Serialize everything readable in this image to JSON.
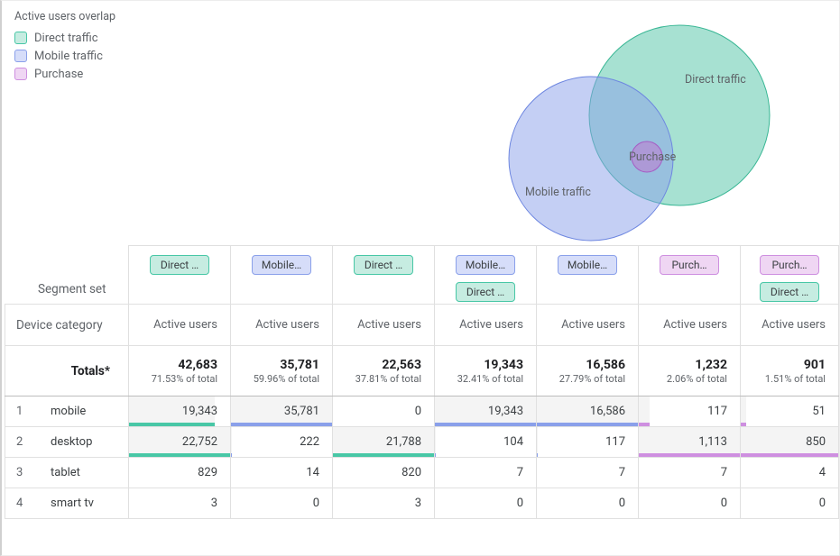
{
  "legend_title": "Active users overlap",
  "segments": [
    {
      "id": "direct",
      "label": "Direct traffic",
      "fill": "#c6ece1",
      "stroke": "#48c7a6"
    },
    {
      "id": "mobile",
      "label": "Mobile traffic",
      "fill": "#d6ddf9",
      "stroke": "#8aa0ea"
    },
    {
      "id": "purchase",
      "label": "Purchase",
      "fill": "#efd6f3",
      "stroke": "#ce8fe0"
    }
  ],
  "venn_labels": {
    "direct": "Direct traffic",
    "mobile": "Mobile traffic",
    "purchase": "Purchase"
  },
  "headings": {
    "segment_set": "Segment set",
    "dimension": "Device category",
    "metric": "Active users",
    "totals": "Totals*"
  },
  "columns": [
    {
      "chips": [
        0
      ],
      "total_val": "42,683",
      "total_pct": "71.53% of total"
    },
    {
      "chips": [
        1
      ],
      "total_val": "35,781",
      "total_pct": "59.96% of total"
    },
    {
      "chips": [
        0
      ],
      "total_val": "22,563",
      "total_pct": "37.81% of total"
    },
    {
      "chips": [
        1,
        0
      ],
      "total_val": "19,343",
      "total_pct": "32.41% of total"
    },
    {
      "chips": [
        1
      ],
      "total_val": "16,586",
      "total_pct": "27.79% of total"
    },
    {
      "chips": [
        2
      ],
      "total_val": "1,232",
      "total_pct": "2.06% of total"
    },
    {
      "chips": [
        2,
        0
      ],
      "total_val": "901",
      "total_pct": "1.51% of total"
    }
  ],
  "chip_text": {
    "direct": "Direct …",
    "mobile": "Mobile…",
    "purchase": "Purch…"
  },
  "rows": [
    {
      "idx": "1",
      "category": "mobile",
      "cells": [
        "19,343",
        "35,781",
        "0",
        "19,343",
        "16,586",
        "117",
        "51"
      ]
    },
    {
      "idx": "2",
      "category": "desktop",
      "cells": [
        "22,752",
        "222",
        "21,788",
        "104",
        "117",
        "1,113",
        "850"
      ]
    },
    {
      "idx": "3",
      "category": "tablet",
      "cells": [
        "829",
        "14",
        "820",
        "7",
        "7",
        "7",
        "4"
      ]
    },
    {
      "idx": "4",
      "category": "smart tv",
      "cells": [
        "3",
        "0",
        "3",
        "0",
        "0",
        "0",
        "0"
      ]
    }
  ],
  "chart_data": {
    "type": "venn-plus-table",
    "venn_sets": [
      {
        "name": "Direct traffic",
        "size_hint": 42683
      },
      {
        "name": "Mobile traffic",
        "size_hint": 35781
      },
      {
        "name": "Purchase",
        "size_hint": 1232
      }
    ],
    "table": {
      "dimension": "Device category",
      "metric": "Active users",
      "column_segments": [
        "Direct",
        "Mobile",
        "Direct only",
        "Mobile ∩ Direct",
        "Mobile only",
        "Purchase",
        "Purchase ∩ Direct"
      ],
      "totals": [
        42683,
        35781,
        22563,
        19343,
        16586,
        1232,
        901
      ],
      "totals_pct_of_total": [
        71.53,
        59.96,
        37.81,
        32.41,
        27.79,
        2.06,
        1.51
      ],
      "categories": [
        "mobile",
        "desktop",
        "tablet",
        "smart tv"
      ],
      "values": [
        [
          19343,
          35781,
          0,
          19343,
          16586,
          117,
          51
        ],
        [
          22752,
          222,
          21788,
          104,
          117,
          1113,
          850
        ],
        [
          829,
          14,
          820,
          7,
          7,
          7,
          4
        ],
        [
          3,
          0,
          3,
          0,
          0,
          0,
          0
        ]
      ]
    }
  }
}
